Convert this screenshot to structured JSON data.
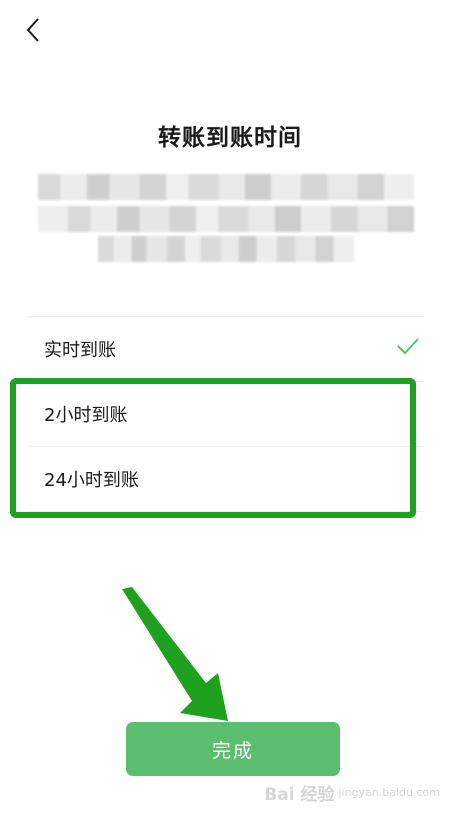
{
  "header": {
    "back_icon": "chevron-left-icon",
    "title": "转账到账时间"
  },
  "options": [
    {
      "label": "实时到账",
      "selected": true
    },
    {
      "label": "2小时到账",
      "selected": false
    },
    {
      "label": "24小时到账",
      "selected": false
    }
  ],
  "check_icon": "checkmark-icon",
  "done_button": {
    "label": "完成"
  },
  "colors": {
    "accent_green": "#1ea11e",
    "button_green": "#5bbd6e",
    "checkmark": "#5bbd6e"
  },
  "watermark": {
    "main": "Bai 经验",
    "sub": "jingyan.baidu.com"
  }
}
